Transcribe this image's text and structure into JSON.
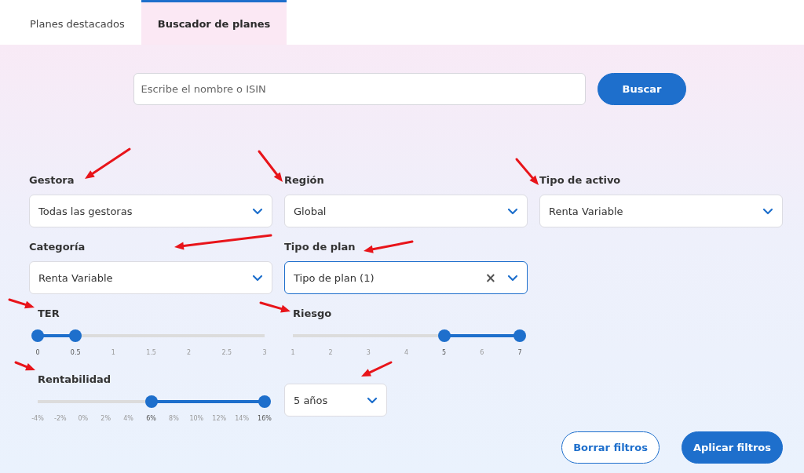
{
  "tabs": [
    {
      "label": "Planes destacados",
      "selected": false
    },
    {
      "label": "Buscador de planes",
      "selected": true
    }
  ],
  "search": {
    "placeholder": "Escribe el nombre o ISIN",
    "button": "Buscar"
  },
  "selects": [
    {
      "label": "Gestora",
      "value": "Todas las gestoras",
      "focused": false
    },
    {
      "label": "Región",
      "value": "Global",
      "focused": false
    },
    {
      "label": "Tipo de activo",
      "value": "Renta Variable",
      "focused": false
    },
    {
      "label": "Categoría",
      "value": "Renta Variable",
      "focused": false
    },
    {
      "label": "Tipo de plan",
      "value": "Tipo de plan (1)",
      "focused": true,
      "clear": "×"
    }
  ],
  "sliders": [
    {
      "label": "TER",
      "ticks": [
        {
          "label": "0",
          "selected": true
        },
        {
          "label": "0.5",
          "selected": true
        },
        {
          "label": "1",
          "selected": false
        },
        {
          "label": "1.5",
          "selected": false
        },
        {
          "label": "2",
          "selected": false
        },
        {
          "label": "2.5",
          "selected": false
        },
        {
          "label": "3",
          "selected": false
        }
      ]
    },
    {
      "label": "Riesgo",
      "ticks": [
        {
          "label": "1",
          "selected": false
        },
        {
          "label": "2",
          "selected": false
        },
        {
          "label": "3",
          "selected": false
        },
        {
          "label": "4",
          "selected": false
        },
        {
          "label": "5",
          "selected": true
        },
        {
          "label": "6",
          "selected": false
        },
        {
          "label": "7",
          "selected": true
        }
      ]
    },
    {
      "label": "Rentabilidad",
      "ticks": [
        {
          "label": "-4%",
          "selected": false
        },
        {
          "label": "-2%",
          "selected": false
        },
        {
          "label": "0%",
          "selected": false
        },
        {
          "label": "2%",
          "selected": false
        },
        {
          "label": "4%",
          "selected": false
        },
        {
          "label": "6%",
          "selected": true
        },
        {
          "label": "8%",
          "selected": false
        },
        {
          "label": "10%",
          "selected": false
        },
        {
          "label": "12%",
          "selected": false
        },
        {
          "label": "14%",
          "selected": false
        },
        {
          "label": "16%",
          "selected": true
        }
      ]
    }
  ],
  "period": {
    "value": "5 años"
  },
  "buttons": [
    {
      "label": "Borrar filtros",
      "kind": "outline"
    },
    {
      "label": "Aplicar filtros",
      "kind": "primary"
    }
  ]
}
